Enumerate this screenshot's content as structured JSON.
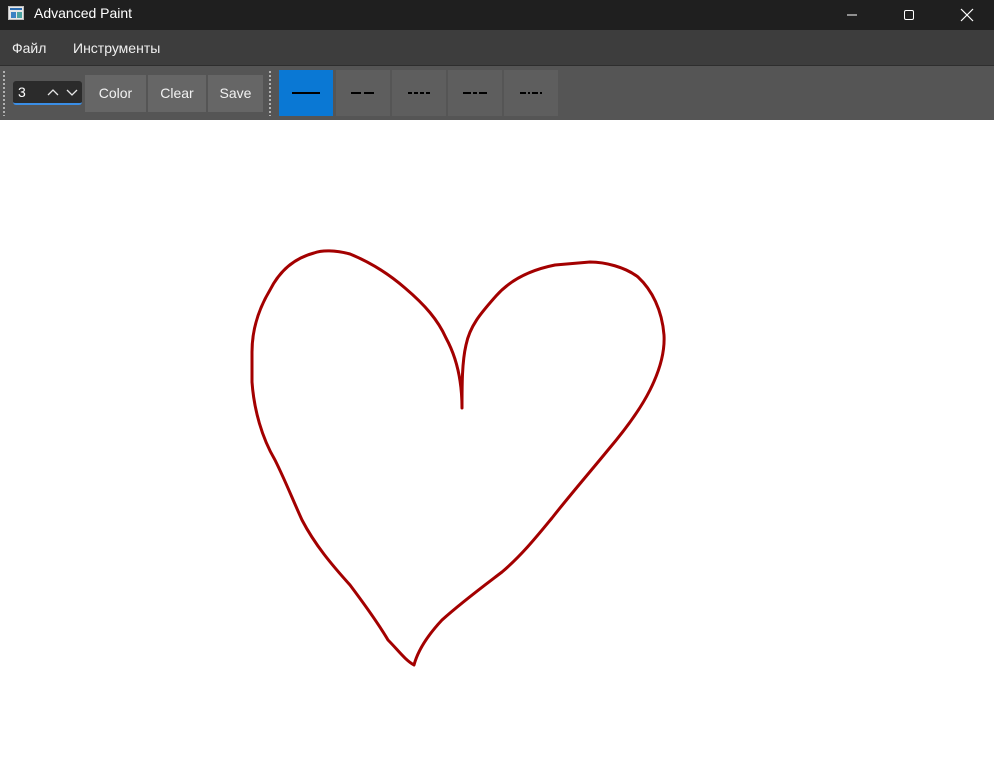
{
  "window": {
    "title": "Advanced Paint",
    "controls": {
      "minimize_icon": "minimize-icon",
      "maximize_icon": "maximize-icon",
      "close_icon": "close-icon"
    }
  },
  "menu": {
    "items": [
      {
        "label": "Файл"
      },
      {
        "label": "Инструменты"
      }
    ]
  },
  "toolbar": {
    "thickness": {
      "value": "3",
      "up_icon": "chevron-up-icon",
      "down_icon": "chevron-down-icon"
    },
    "color_label": "Color",
    "clear_label": "Clear",
    "save_label": "Save",
    "dash_styles": [
      {
        "name": "solid",
        "active": true
      },
      {
        "name": "long-dash",
        "active": false
      },
      {
        "name": "dotted",
        "active": false
      },
      {
        "name": "dash",
        "active": false
      },
      {
        "name": "dash-dot",
        "active": false
      }
    ]
  },
  "canvas": {
    "stroke_color": "#a30000",
    "shape": "heart"
  },
  "colors": {
    "titlebar": "#1f1f1f",
    "menubar": "#3d3d3d",
    "toolbar": "#555555",
    "button": "#666666",
    "active_accent": "#0a78d4",
    "stroke": "#a30000"
  }
}
